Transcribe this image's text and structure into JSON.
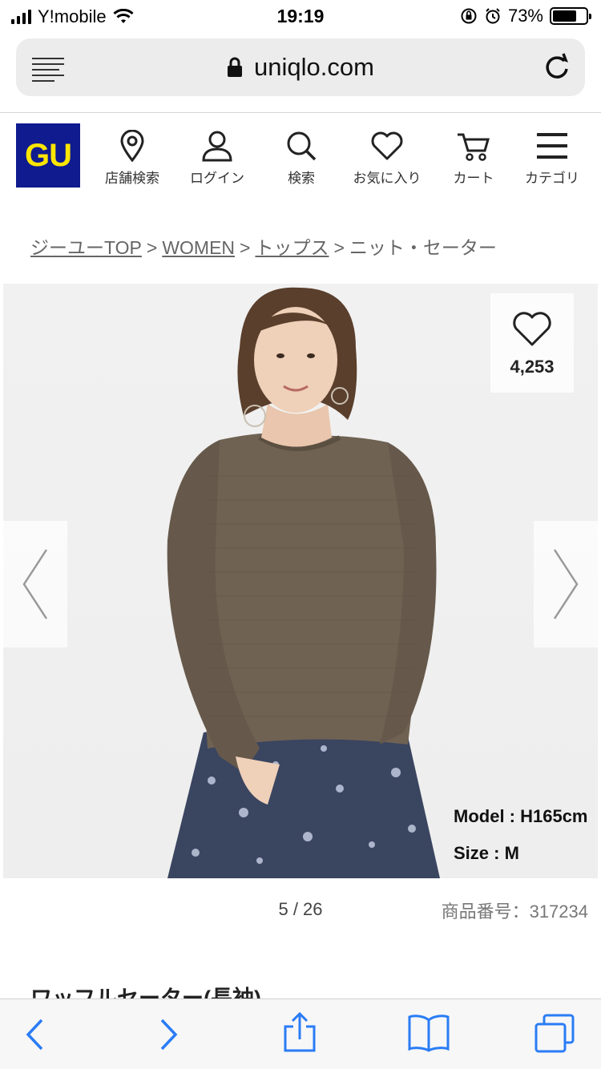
{
  "status_bar": {
    "carrier": "Y!mobile",
    "time": "19:19",
    "battery_percent": "73%",
    "battery_level": 0.73
  },
  "browser": {
    "url": "uniqlo.com"
  },
  "header": {
    "logo_text": "GU",
    "logo_bg_color": "#0f1b8e",
    "logo_text_color": "#ffe600",
    "nav": [
      {
        "label": "店舗検索",
        "icon": "location-pin-icon"
      },
      {
        "label": "ログイン",
        "icon": "user-icon"
      },
      {
        "label": "検索",
        "icon": "search-icon"
      },
      {
        "label": "お気に入り",
        "icon": "heart-icon"
      },
      {
        "label": "カート",
        "icon": "cart-icon"
      },
      {
        "label": "カテゴリ",
        "icon": "hamburger-menu-icon"
      }
    ]
  },
  "breadcrumb": {
    "items": [
      "ジーユーTOP",
      "WOMEN",
      "トップス",
      "ニット・セーター"
    ],
    "separator": ">"
  },
  "product": {
    "like_count": "4,253",
    "model_height": "Model : H165cm",
    "model_size": "Size : M",
    "pager": "5 / 26",
    "code": "商品番号：317234",
    "title": "ワッフルセーター(長袖)"
  }
}
